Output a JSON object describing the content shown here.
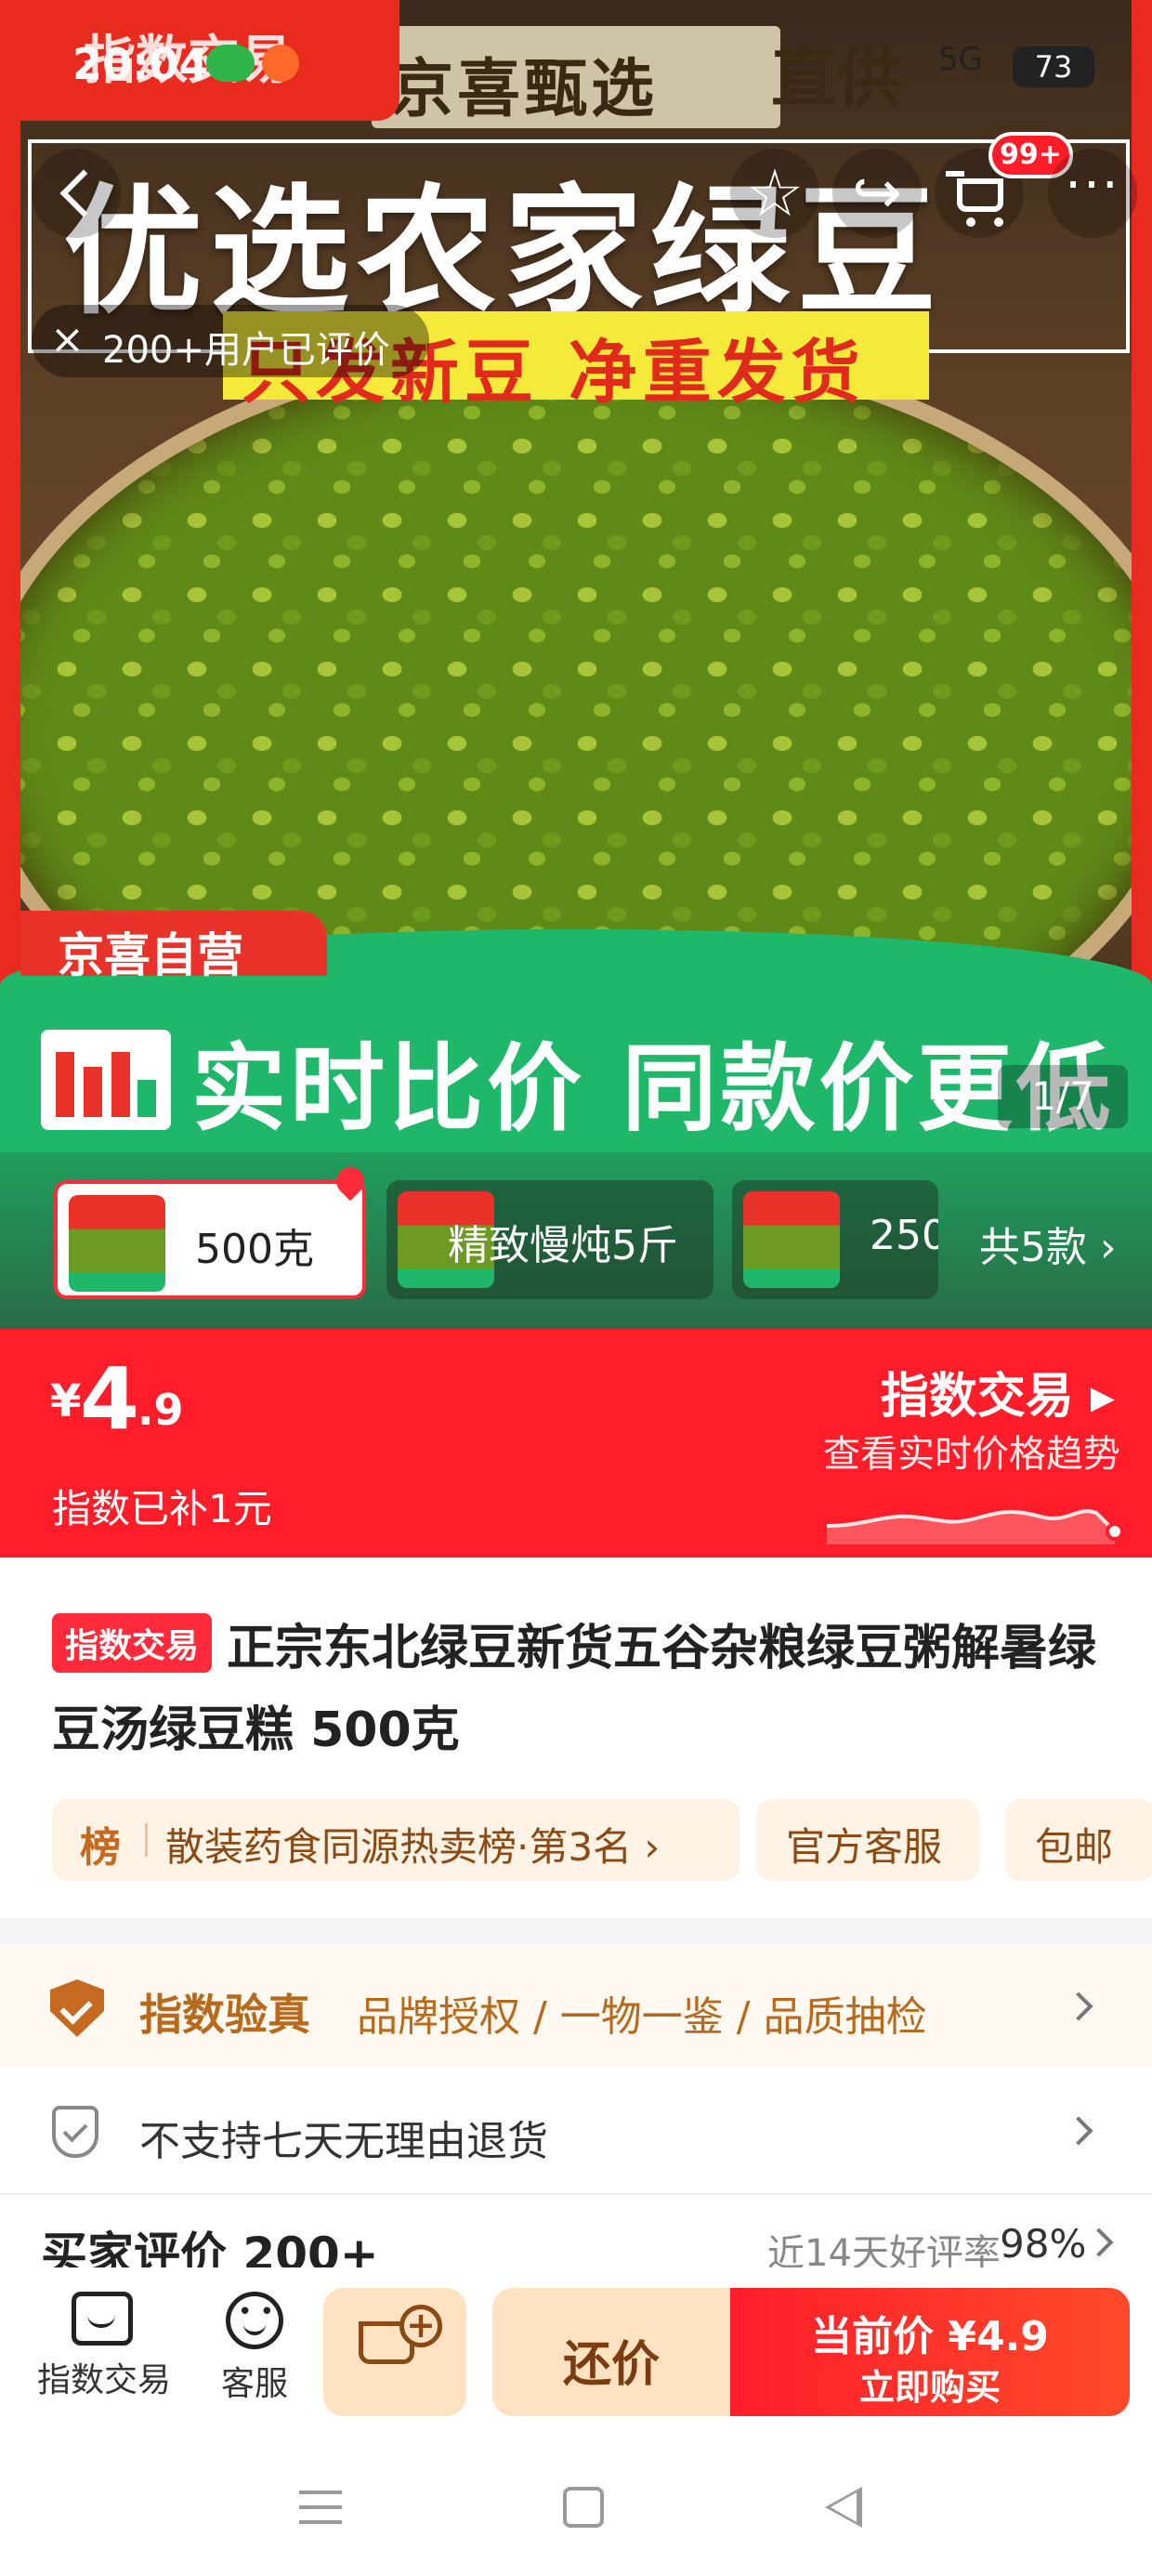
{
  "status_bar": {
    "time": "20:04",
    "signal": "5G",
    "battery": "73"
  },
  "hero": {
    "brand_chip": "指数交易",
    "top_banner": "京喜甄选",
    "top_banner_suffix": "直供",
    "headline": "优选农家绿豆",
    "sub_headline": "只发新豆  净重发货",
    "self_operated": "京喜自营",
    "slogan": "实时比价  同款价更低",
    "image_counter": "1/7",
    "review_count": "200+用户已评价",
    "close_symbol": "×"
  },
  "nav": {
    "cart_badge": "99+",
    "more": "···"
  },
  "variants": {
    "items": [
      {
        "label": "500克"
      },
      {
        "label": "精致慢炖5斤"
      },
      {
        "label": "250"
      }
    ],
    "more_label": "共5款"
  },
  "price": {
    "currency": "¥",
    "integer": "4",
    "decimal": ".9",
    "subsidy": "指数已补1元",
    "trade_link": "指数交易",
    "trend_link": "查看实时价格趋势"
  },
  "product": {
    "tag": "指数交易",
    "title": "正宗东北绿豆新货五谷杂粮绿豆粥解暑绿豆汤绿豆糕 500克"
  },
  "chips": {
    "rank_badge": "榜",
    "rank_text": "散装药食同源热卖榜·第3名",
    "service": "官方客服",
    "shipping": "包邮"
  },
  "guarantee": {
    "title": "指数验真",
    "details": "品牌授权 / 一物一鉴 / 品质抽检",
    "return_policy": "不支持七天无理由退货"
  },
  "reviews": {
    "header": "买家评价 200+",
    "rate_label": "近14天好评率",
    "rate_value": "98%"
  },
  "action_bar": {
    "trade_label": "指数交易",
    "service_label": "客服",
    "counter_offer": "还价",
    "buy_line1": "当前价 ¥4.9",
    "buy_line2": "立即购买"
  },
  "colors": {
    "primary_red": "#ff1d2a",
    "green": "#1fb86a",
    "gold": "#b86a1c"
  }
}
